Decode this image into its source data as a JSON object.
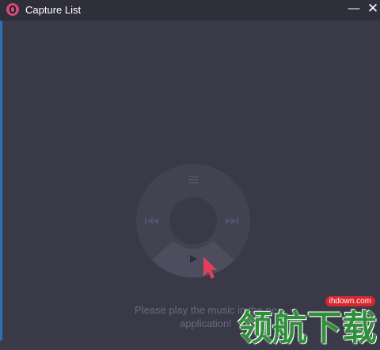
{
  "window": {
    "title": "Capture List",
    "minimize_symbol": "—",
    "close_symbol": "✕"
  },
  "player": {
    "menu_icon": "hamburger-menu-icon",
    "prev_icon": "skip-previous-icon",
    "next_icon": "skip-next-icon",
    "play_icon": "play-icon"
  },
  "message": {
    "line1": "Please play the music in the ne",
    "line2": "application!"
  },
  "watermark": {
    "site": "ihdown.com",
    "text": "领航下载"
  },
  "colors": {
    "accent": "#d14a72",
    "cursor": "#e0405a",
    "watermark_green": "#2f8f3a",
    "watermark_red": "#d8262e"
  }
}
